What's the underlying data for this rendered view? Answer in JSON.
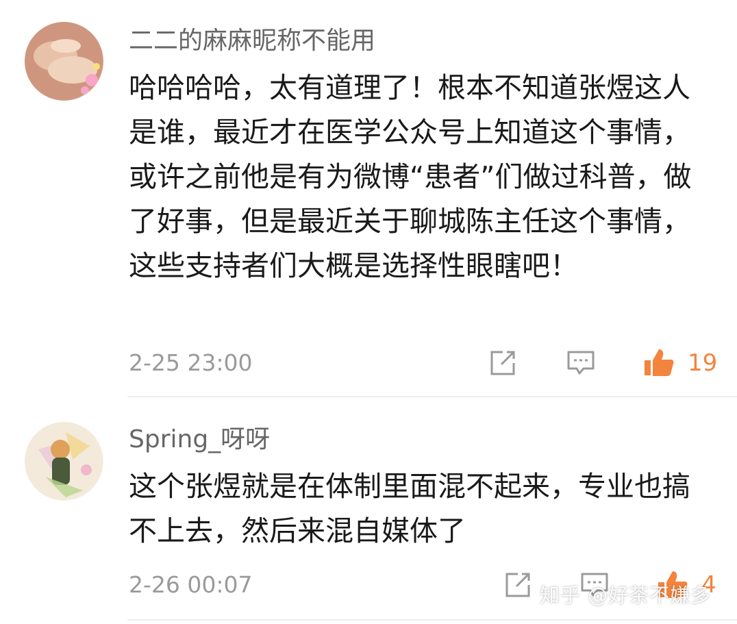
{
  "comments": [
    {
      "username": "二二的麻麻昵称不能用",
      "text": "哈哈哈哈，太有道理了！根本不知道张煜这人是谁，最近才在医学公众号上知道这个事情，或许之前他是有为微博“患者”们做过科普，做了好事，但是最近关于聊城陈主任这个事情，这些支持者们大概是选择性眼瞎吧！",
      "time": "2-25 23:00",
      "likes": "19"
    },
    {
      "username": "Spring_呀呀",
      "text": "这个张煜就是在体制里面混不起来，专业也搞不上去，然后来混自媒体了",
      "time": "2-26 00:07",
      "likes": "4"
    }
  ],
  "watermark": "知乎 @好茶不嫌多",
  "colors": {
    "accent": "#f3843d",
    "meta": "#9a9a9a",
    "username": "#666666"
  },
  "icons": [
    "share-icon",
    "reply-icon",
    "thumbs-up-icon"
  ]
}
